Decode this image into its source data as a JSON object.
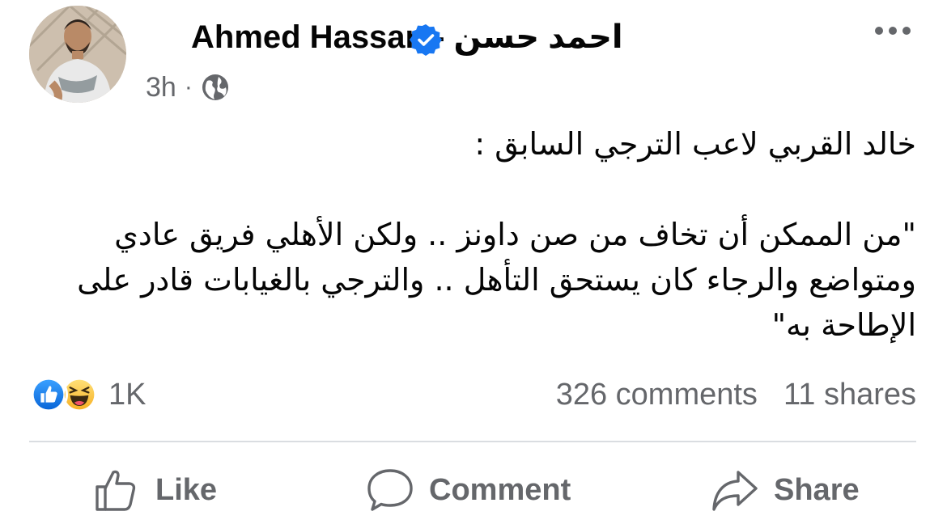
{
  "post": {
    "author_name": "Ahmed Hassan - احمد حسن",
    "time": "3h",
    "separator": "·",
    "privacy_icon": "globe-icon",
    "verified_icon": "verified-badge-icon",
    "more_icon": "more-options-icon",
    "body_lines": [
      "خالد القربي لاعب الترجي السابق :",
      "\"من الممكن أن تخاف من صن داونز .. ولكن الأهلي فريق عادي ومتواضع والرجاء كان يستحق التأهل .. والترجي بالغيابات قادر على الإطاحة به\""
    ]
  },
  "engagement": {
    "reaction_icons": [
      "like-reaction-icon",
      "haha-reaction-icon"
    ],
    "reaction_count": "1K",
    "comments": "326 comments",
    "shares": "11 shares"
  },
  "actions": {
    "like": "Like",
    "comment": "Comment",
    "share": "Share"
  },
  "colors": {
    "secondary_text": "#65676b",
    "facebook_blue": "#1877f2",
    "divider": "#dadde1"
  }
}
